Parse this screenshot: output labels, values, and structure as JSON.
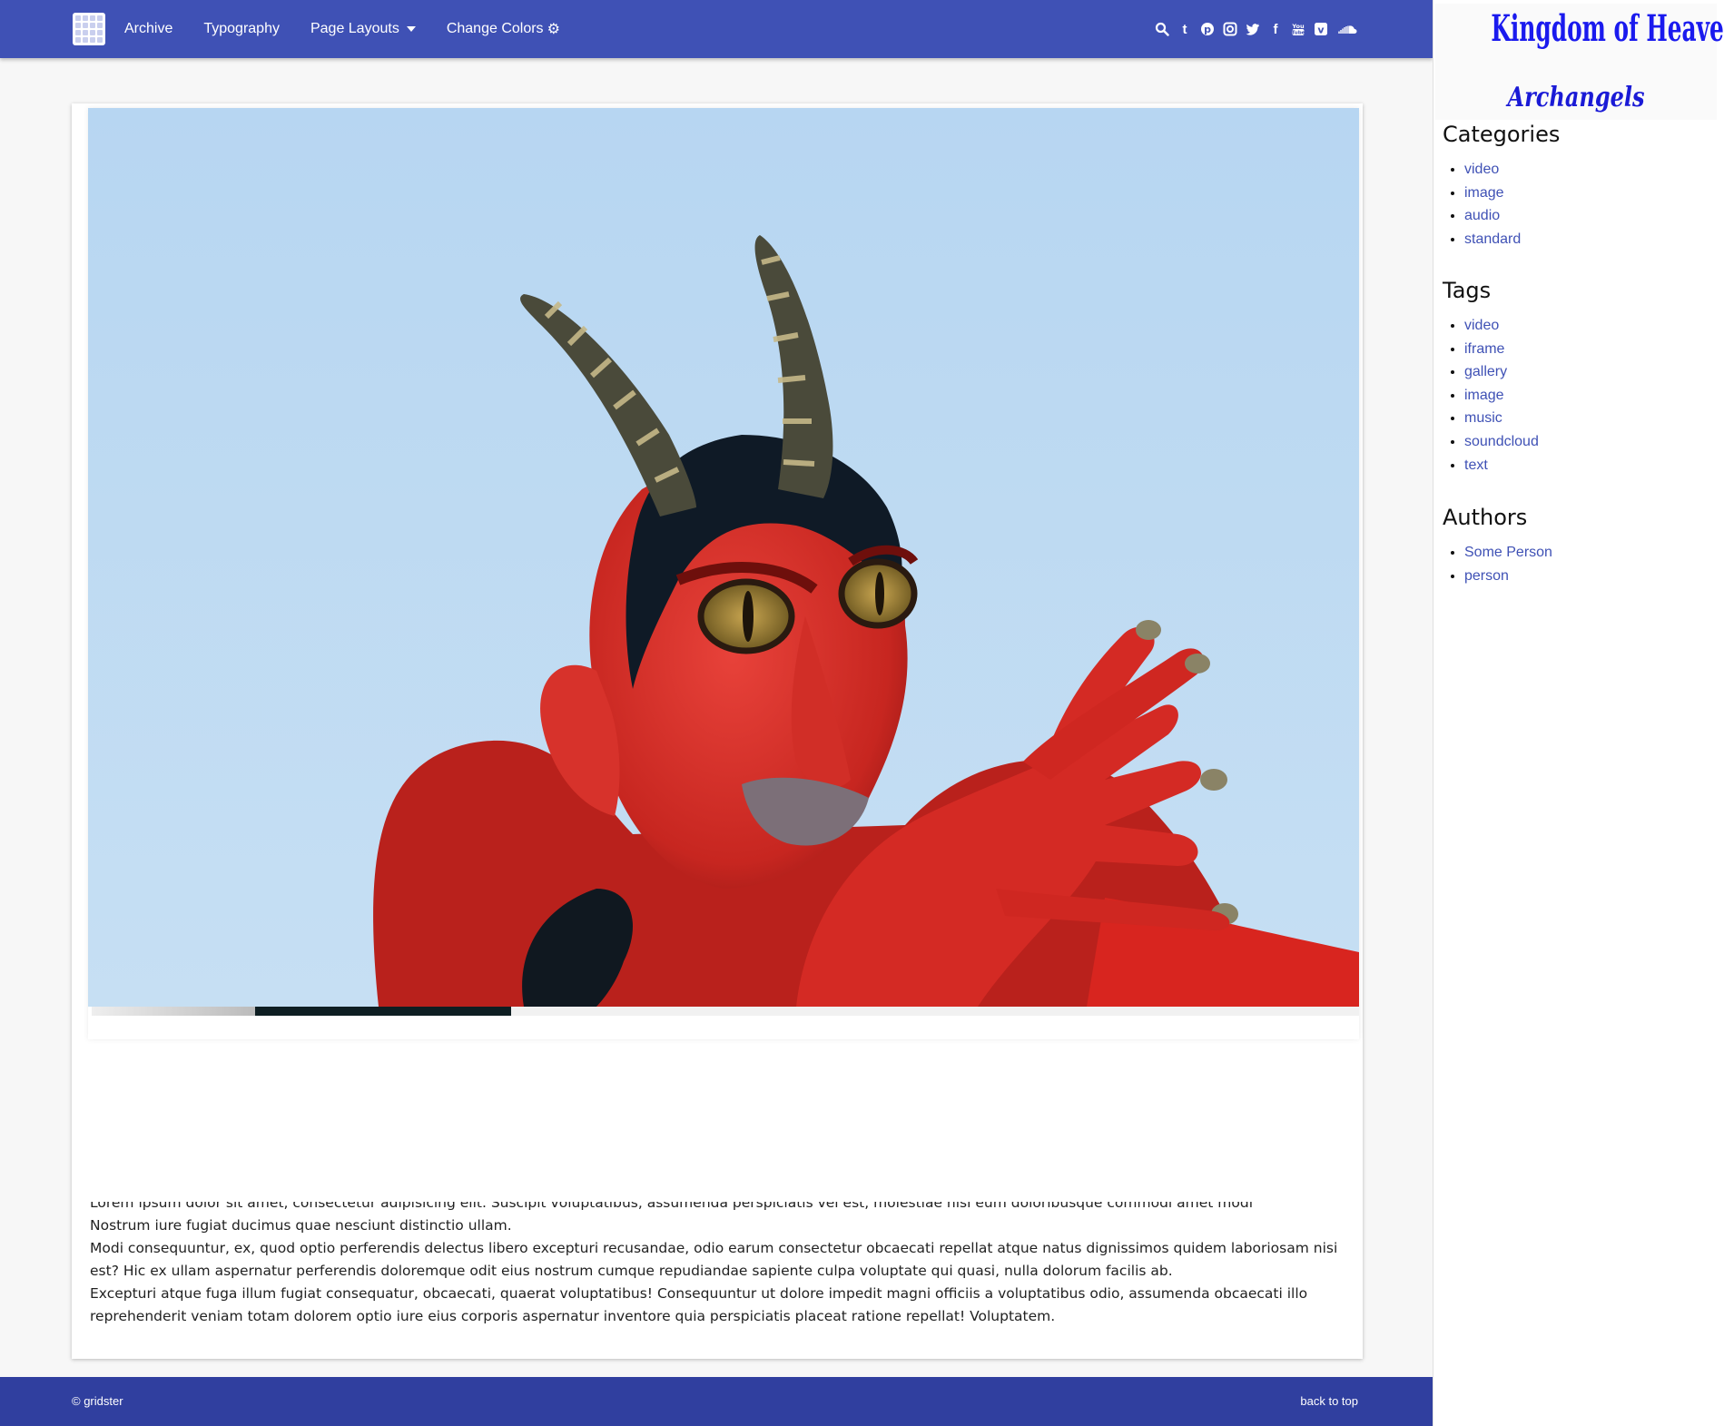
{
  "nav": {
    "links": [
      "Archive",
      "Typography",
      "Page Layouts",
      "Change Colors"
    ],
    "social_icons": [
      "search-icon",
      "tumblr-icon",
      "pinterest-icon",
      "instagram-icon",
      "twitter-icon",
      "facebook-icon",
      "youtube-icon",
      "vimeo-icon",
      "soundcloud-icon"
    ]
  },
  "hero": {
    "image": "red-devil-statue-photo",
    "progress": 0.33
  },
  "article": {
    "paragraphs": [
      "Lorem ipsum dolor sit amet, consectetur adipisicing elit. Suscipit voluptatibus, assumenda perspiciatis vel est, molestiae nisi eum doloribusque commodi amet modi repellendus.",
      "Nostrum iure fugiat ducimus quae nesciunt distinctio ullam.",
      "Modi consequuntur, ex, quod optio perferendis delectus libero excepturi recusandae, odio earum consectetur obcaecati repellat atque natus dignissimos quidem laboriosam nisi est? Hic ex ullam aspernatur perferendis doloremque odit eius nostrum cumque repudiandae sapiente culpa voluptate qui quasi, nulla dolorum facilis ab.",
      "Excepturi atque fuga illum fugiat consequatur, obcaecati, quaerat voluptatibus! Consequuntur ut dolore impedit magni officiis a voluptatibus odio, assumenda obcaecati illo reprehenderit veniam totam dolorem optio iure eius corporis aspernatur inventore quia perspiciatis placeat ratione repellat! Voluptatem."
    ]
  },
  "footer": {
    "copyright": "© gridster",
    "back_to_top": "back to top"
  },
  "sidebar": {
    "brand_title": "Kingdom of Heaven TV",
    "brand_subtitle": "Archangels",
    "categories": {
      "title": "Categories",
      "items": [
        "video",
        "image",
        "audio",
        "standard"
      ]
    },
    "tags": {
      "title": "Tags",
      "items": [
        "video",
        "iframe",
        "gallery",
        "image",
        "music",
        "soundcloud",
        "text"
      ]
    },
    "authors": {
      "title": "Authors",
      "items": [
        "Some Person",
        "person"
      ]
    }
  },
  "colors": {
    "navbar": "#3f51b5",
    "footer": "#303f9f",
    "link": "#3f51b5",
    "brand": "#1a1aee"
  }
}
